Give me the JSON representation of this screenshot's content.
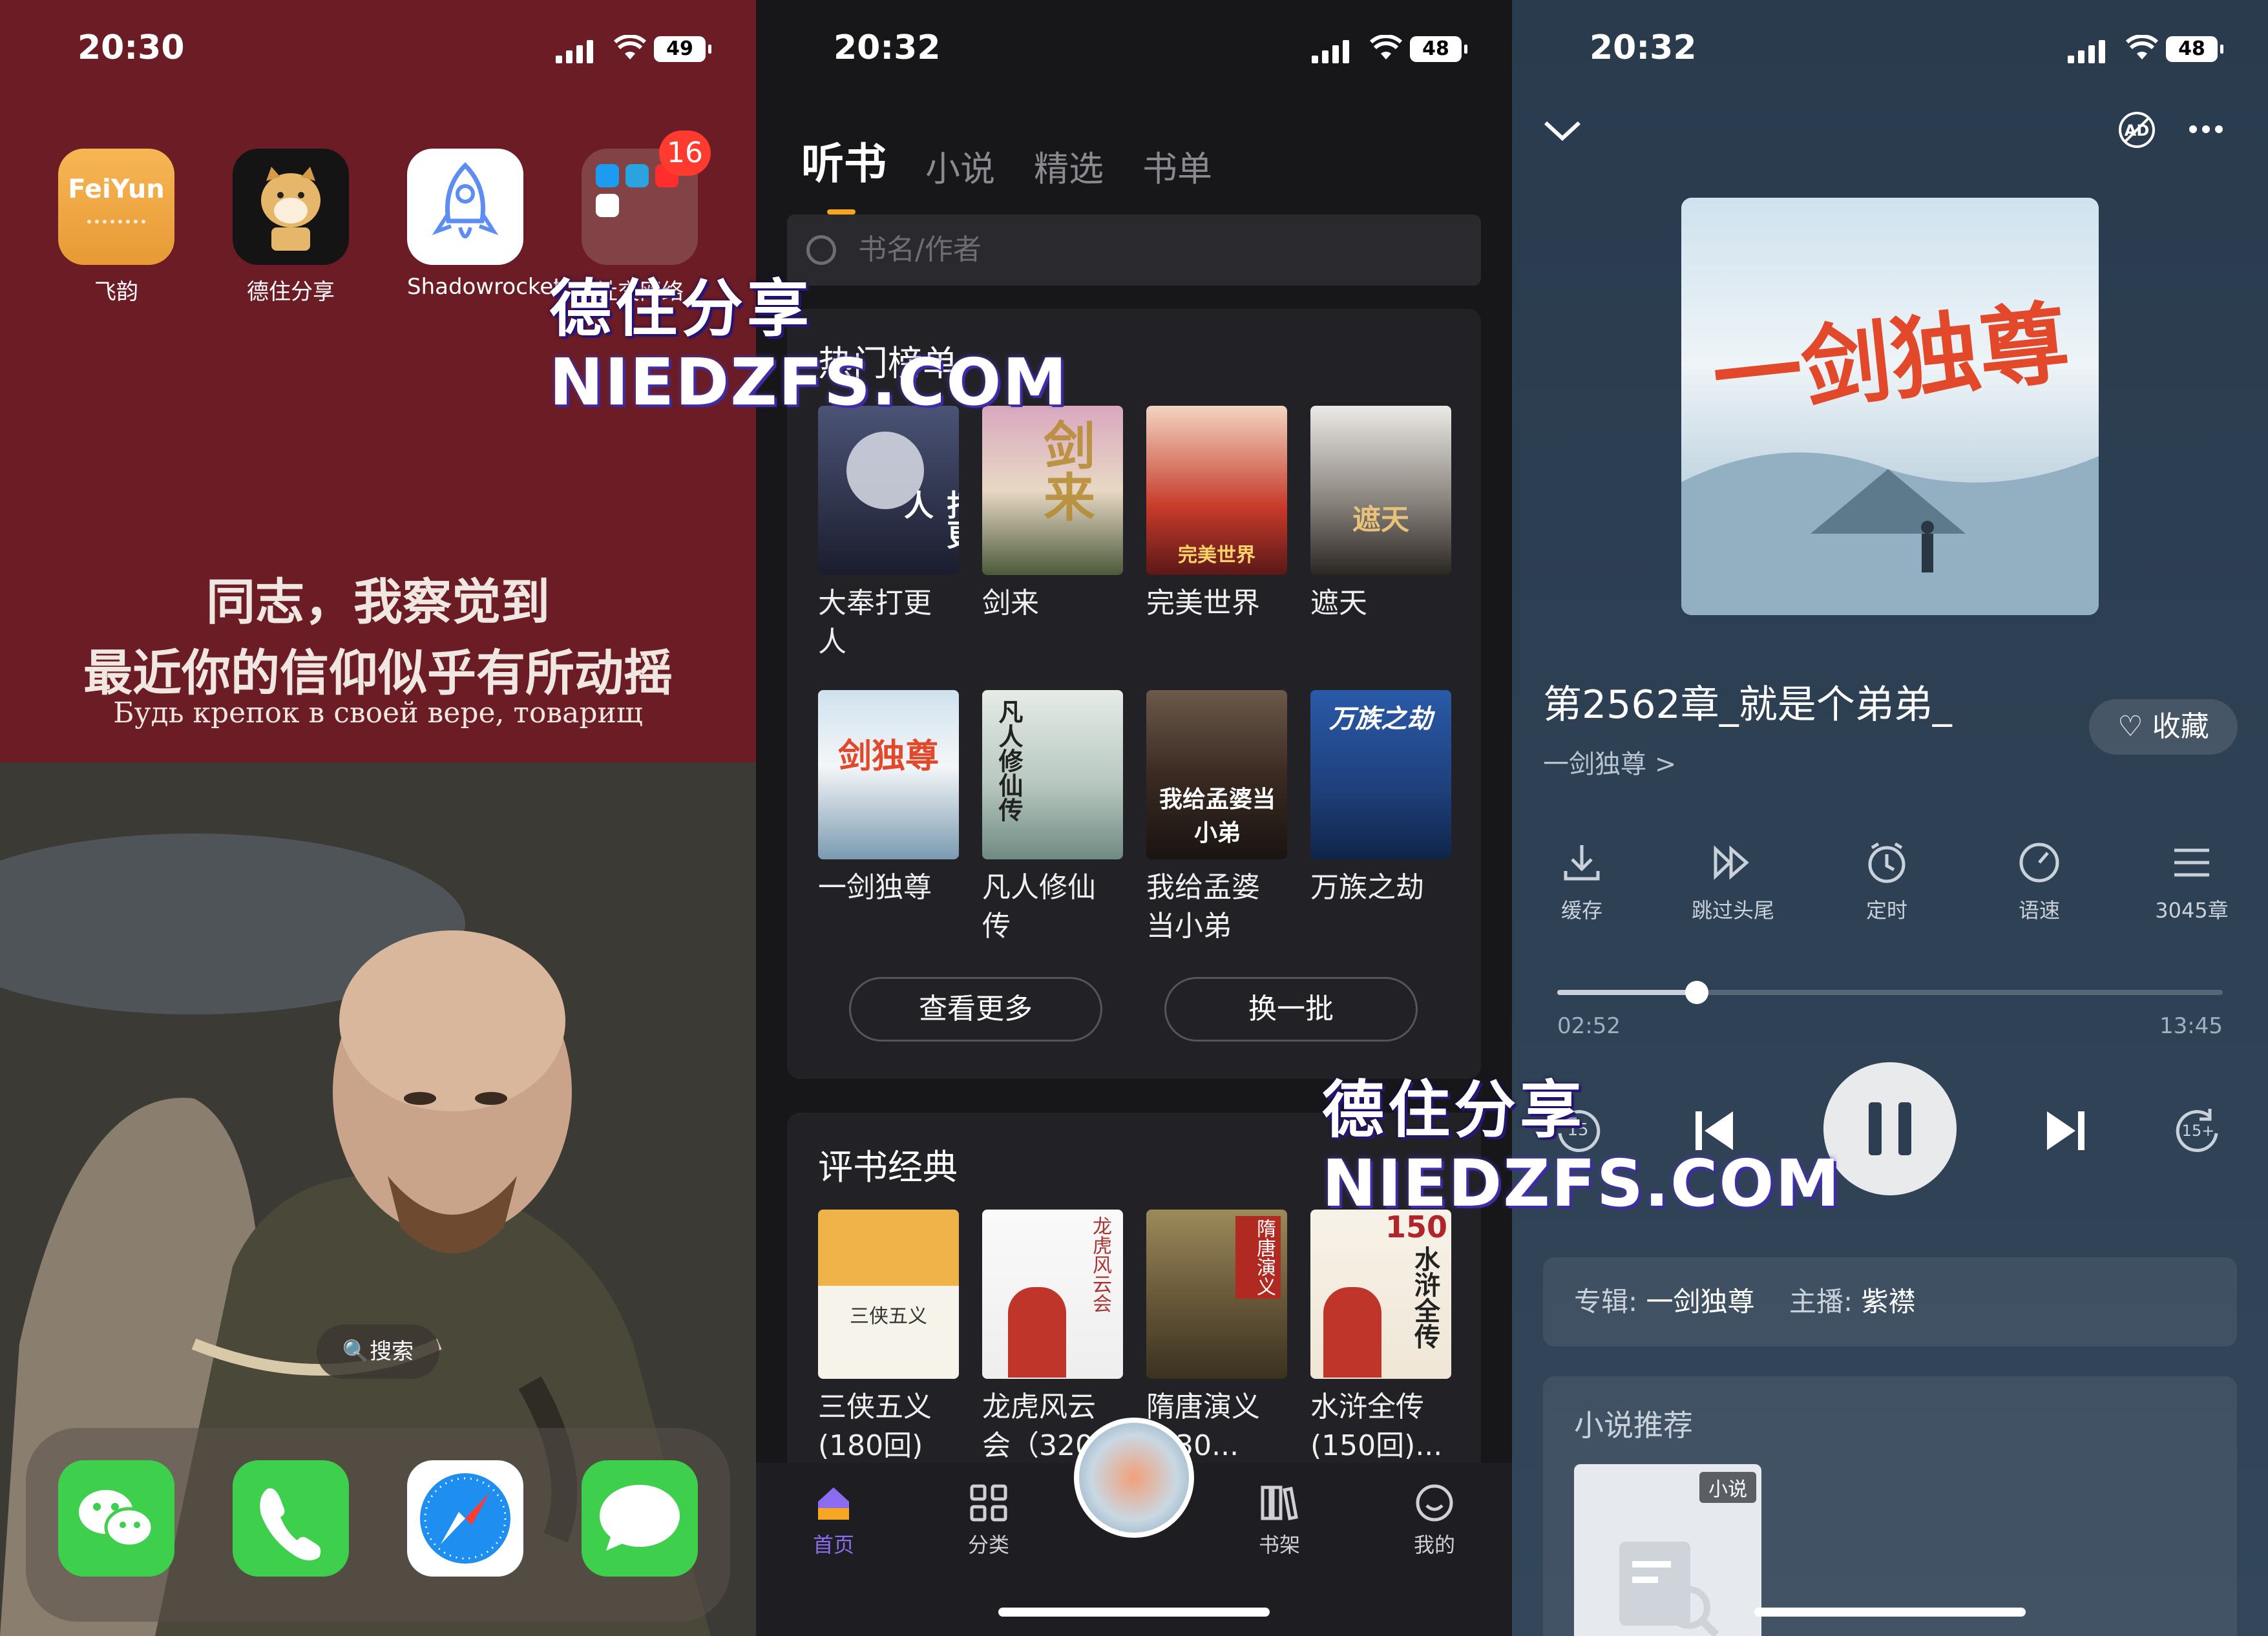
{
  "watermark": {
    "cn": "德住分享",
    "en": "NIEDZFS.COM"
  },
  "phone1": {
    "status": {
      "time": "20:30",
      "battery": "49"
    },
    "apps": [
      {
        "name": "飞韵",
        "icon": "feiyun-icon",
        "icon_text": "FeiYun"
      },
      {
        "name": "德住分享",
        "icon": "doge-icon"
      },
      {
        "name": "Shadowrocket",
        "icon": "rocket-icon"
      },
      {
        "name": "社交网络",
        "icon": "folder-icon",
        "badge": "16"
      }
    ],
    "quote": {
      "line1": "同志，我察觉到",
      "line2": "最近你的信仰似乎有所动摇",
      "line3": "Будь крепок в своей вере, товарищ"
    },
    "search_label": "搜索",
    "dock": [
      "wechat-icon",
      "phone-icon",
      "safari-icon",
      "messages-icon"
    ],
    "colors": {
      "wallpaper_top": "#6b1c24"
    }
  },
  "phone2": {
    "status": {
      "time": "20:32",
      "battery": "48"
    },
    "tabs": [
      "听书",
      "小说",
      "精选",
      "书单"
    ],
    "active_tab": "听书",
    "search_placeholder": "书名/作者",
    "hot": {
      "title": "热门榜单",
      "books": [
        {
          "name": "大奉打更人",
          "cover_text": "打更人"
        },
        {
          "name": "剑来",
          "cover_text": "剑来"
        },
        {
          "name": "完美世界",
          "cover_text": "完美世界"
        },
        {
          "name": "遮天",
          "cover_text": "遮天"
        },
        {
          "name": "一剑独尊",
          "cover_text": "剑独尊"
        },
        {
          "name": "凡人修仙传",
          "cover_text": "凡人修仙传"
        },
        {
          "name": "我给孟婆当小弟",
          "cover_text": "我给孟婆当小弟"
        },
        {
          "name": "万族之劫",
          "cover_text": "万族之劫"
        }
      ],
      "more": "查看更多",
      "refresh": "换一批"
    },
    "classic": {
      "title": "评书经典",
      "books": [
        {
          "name": "三侠五义(180回)",
          "cover_text": "三侠五义"
        },
        {
          "name": "龙虎风云会（320...",
          "cover_text": "龙虎风云会"
        },
        {
          "name": "隋唐演义(230...",
          "cover_text": "隋唐演义"
        },
        {
          "name": "水浒全传(150回)...",
          "cover_text": "水浒全传",
          "cover_num": "150"
        }
      ]
    },
    "tabbar": [
      "首页",
      "分类",
      "书架",
      "我的"
    ],
    "colors": {
      "accent": "#f6a623",
      "tab_active": "#8b6cf0"
    }
  },
  "phone3": {
    "status": {
      "time": "20:32",
      "battery": "48"
    },
    "cover_text": "一剑独尊",
    "chapter": "第2562章_就是个弟弟_",
    "album_link": "一剑独尊 >",
    "fav": "收藏",
    "tools": [
      "缓存",
      "跳过头尾",
      "定时",
      "语速",
      "3045章"
    ],
    "progress": {
      "current": "02:52",
      "total": "13:45",
      "fraction": 0.21
    },
    "skip_back": "15",
    "skip_fwd": "15+",
    "album_label": "专辑:",
    "album": "一剑独尊",
    "host_label": "主播:",
    "host": "紫襟",
    "rec_title": "小说推荐",
    "rec_tag": "小说"
  }
}
